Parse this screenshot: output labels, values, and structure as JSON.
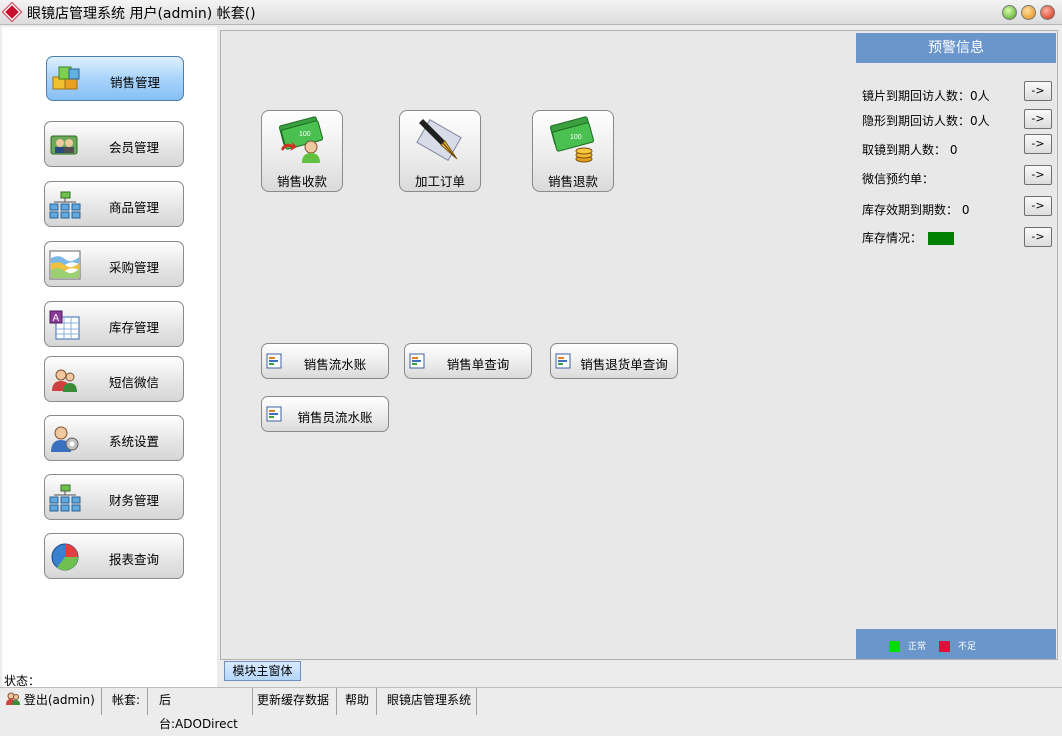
{
  "window": {
    "title": "眼镜店管理系统 用户(admin) 帐套()"
  },
  "sidebar": {
    "items": [
      {
        "label": "销售管理",
        "icon": "cubes-icon",
        "active": true
      },
      {
        "label": "会员管理",
        "icon": "member-card-icon"
      },
      {
        "label": "商品管理",
        "icon": "org-tree-icon"
      },
      {
        "label": "采购管理",
        "icon": "wave-chart-icon"
      },
      {
        "label": "库存管理",
        "icon": "spreadsheet-icon"
      },
      {
        "label": "短信微信",
        "icon": "users-icon"
      },
      {
        "label": "系统设置",
        "icon": "user-settings-icon"
      },
      {
        "label": "财务管理",
        "icon": "org-tree-icon"
      },
      {
        "label": "报表查询",
        "icon": "pie-chart-icon"
      }
    ]
  },
  "main": {
    "big_buttons": [
      {
        "label": "销售收款",
        "icon": "money-user-icon"
      },
      {
        "label": "加工订单",
        "icon": "fountain-pen-icon"
      },
      {
        "label": "销售退款",
        "icon": "money-coins-icon"
      }
    ],
    "small_buttons": [
      {
        "label": "销售流水账"
      },
      {
        "label": "销售单查询"
      },
      {
        "label": "销售退货单查询"
      },
      {
        "label": "销售员流水账"
      }
    ]
  },
  "warning": {
    "title": "预警信息",
    "rows": [
      {
        "text": "镜片到期回访人数：0人"
      },
      {
        "text": "隐形到期回访人数：0人"
      },
      {
        "text": "取镜到期人数：  0"
      },
      {
        "text": "微信预约单："
      },
      {
        "text": "库存效期到期数：  0"
      },
      {
        "text": "库存情况："
      }
    ],
    "arrow_label": "->",
    "stock_color": "#008000",
    "legend": [
      {
        "label": "正常",
        "color": "#00dd00"
      },
      {
        "label": "不足",
        "color": "#e0103a"
      }
    ]
  },
  "tabs": {
    "main_form": "模块主窗体"
  },
  "status": {
    "label": "状态：",
    "items": [
      {
        "text": "登出(admin)"
      },
      {
        "text": "帐套:"
      },
      {
        "text": "后台:ADODirect"
      },
      {
        "text": "更新缓存数据"
      },
      {
        "text": "帮助"
      },
      {
        "text": "眼镜店管理系统"
      }
    ]
  },
  "colors": {
    "accent": "#6a96cc",
    "active_button": "#a9d4fb"
  }
}
